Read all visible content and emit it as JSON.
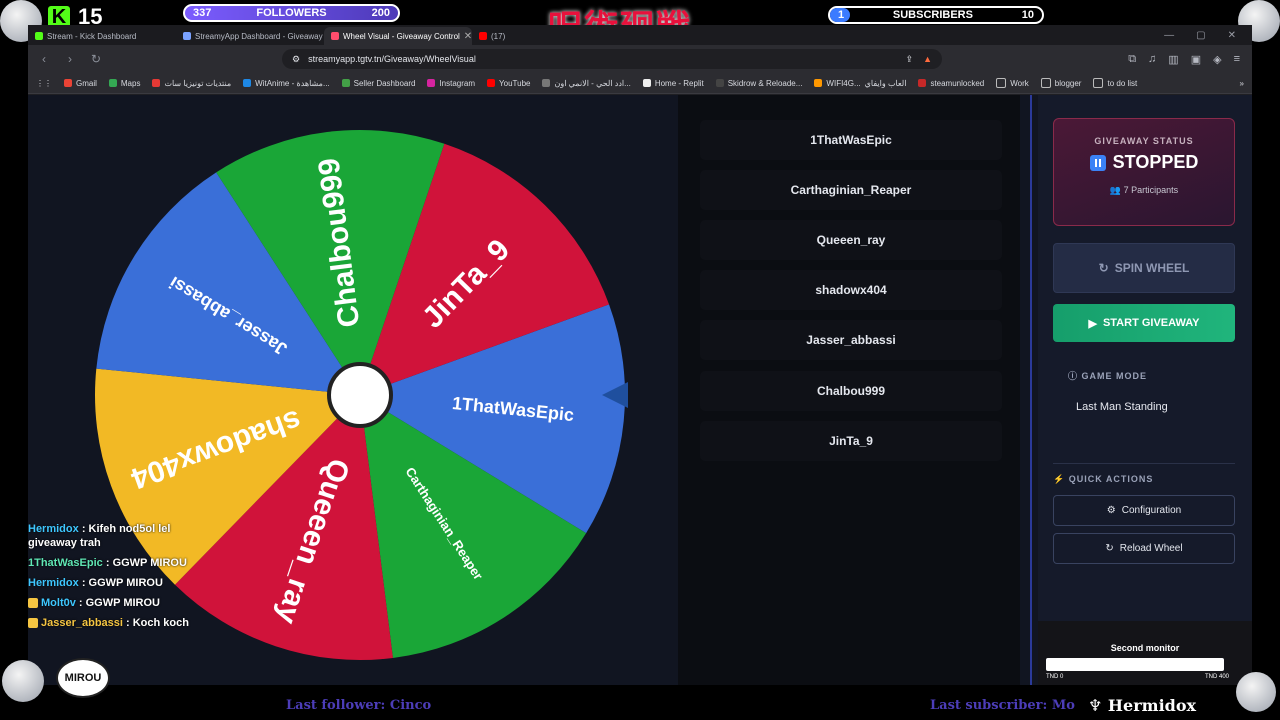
{
  "overlay": {
    "kick_count": "15",
    "followers": {
      "current": "337",
      "label": "FOLLOWERS",
      "goal": "200"
    },
    "subscribers": {
      "current": "1",
      "label": "SUBSCRIBERS",
      "goal": "10"
    },
    "jp_title": "呪術廻戦",
    "last_follower": "Last follower: Cinco",
    "last_subscriber": "Last subscriber: Mo",
    "streamer": "Hermidox",
    "logo": "MIROU"
  },
  "browser": {
    "tabs": [
      {
        "label": "Stream - Kick Dashboard",
        "color": "#53fc18"
      },
      {
        "label": "StreamyApp Dashboard - Giveaway C",
        "color": "#7aa2ff"
      },
      {
        "label": "Wheel Visual - Giveaway Control",
        "color": "#ff4d6d"
      },
      {
        "label": "(17)",
        "color": "#ff0000"
      }
    ],
    "url": "streamyapp.tgtv.tn/Giveaway/WheelVisual",
    "bookmarks": [
      "Gmail",
      "Maps",
      "منتديات تونيزيا سات",
      "WitAnime - مشاهدة...",
      "Seller Dashboard",
      "Instagram",
      "YouTube",
      "ادد الحي - الانمي اون...",
      "Home - Replit",
      "Skidrow & Reloade...",
      "WIFI4G...",
      "العاب وايفاي",
      "steamunlocked",
      "Work",
      "blogger",
      "to do list"
    ]
  },
  "wheel": {
    "segments": [
      {
        "name": "1ThatWasEpic",
        "color": "#3a6fd8"
      },
      {
        "name": "Carthaginian_Reaper",
        "color": "#1aa637"
      },
      {
        "name": "Queeen_ray",
        "color": "#d0133a"
      },
      {
        "name": "shadowx404",
        "color": "#f2b925"
      },
      {
        "name": "Jasser_abbassi",
        "color": "#3a6fd8"
      },
      {
        "name": "Chalbou999",
        "color": "#1aa637"
      },
      {
        "name": "JinTa_9",
        "color": "#d0133a"
      }
    ]
  },
  "participants": [
    "1ThatWasEpic",
    "Carthaginian_Reaper",
    "Queeen_ray",
    "shadowx404",
    "Jasser_abbassi",
    "Chalbou999",
    "JinTa_9"
  ],
  "panel": {
    "status_label": "GIVEAWAY STATUS",
    "status_value": "STOPPED",
    "participants_count": "7 Participants",
    "spin_label": "SPIN WHEEL",
    "start_label": "START GIVEAWAY",
    "game_mode_label": "GAME MODE",
    "game_mode_value": "Last Man Standing",
    "quick_actions_label": "QUICK ACTIONS",
    "config_label": "Configuration",
    "reload_label": "Reload Wheel",
    "monitor_label": "Second monitor",
    "monitor_min": "TND 0",
    "monitor_max": "TND 400"
  },
  "chat": [
    {
      "user": "Hermidox",
      "msg": ": Kifeh nod5ol lel giveaway trah",
      "style": ""
    },
    {
      "user": "1ThatWasEpic",
      "msg": ": GGWP MIROU",
      "style": "green"
    },
    {
      "user": "Hermidox",
      "msg": ": GGWP MIROU",
      "style": ""
    },
    {
      "user": "Molt0v",
      "msg": ": GGWP MIROU",
      "style": ""
    },
    {
      "user": "Jasser_abbassi",
      "msg": ": Koch koch",
      "style": "gold"
    }
  ],
  "colors": {
    "accent_green": "#20b57c",
    "stopped_bg": "#4b1836",
    "divider": "#2b3a9a"
  }
}
